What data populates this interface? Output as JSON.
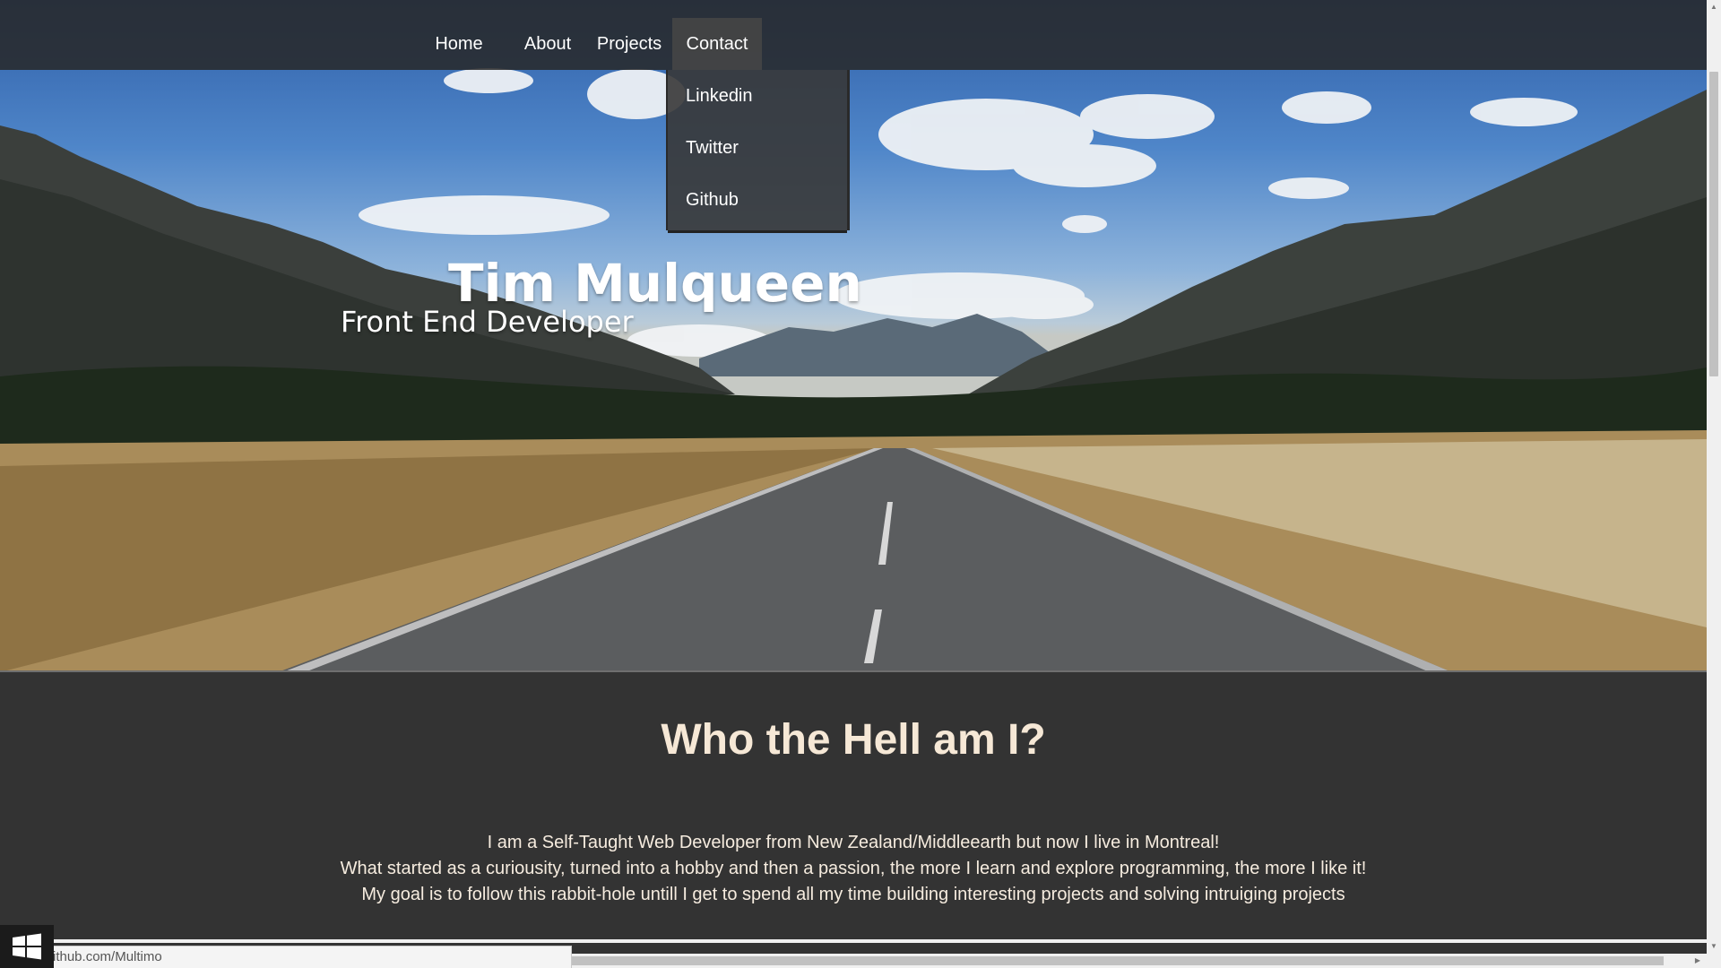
{
  "nav": {
    "items": [
      {
        "label": "Home"
      },
      {
        "label": "About"
      },
      {
        "label": "Projects"
      },
      {
        "label": "Contact"
      }
    ],
    "contact_dropdown": [
      {
        "label": "Linkedin"
      },
      {
        "label": "Twitter"
      },
      {
        "label": "Github"
      }
    ]
  },
  "hero": {
    "name": "Tim Mulqueen",
    "role": "Front End Developer"
  },
  "about": {
    "title": "Who the Hell am I?",
    "lines": [
      "I am a Self-Taught Web Developer from New Zealand/Middleearth but now I live in Montreal!",
      "What started as a curiousity, turned into a hobby and then a passion, the more I learn and explore programming, the more I like it!",
      "My goal is to follow this rabbit-hole untill I get to spend all my time building interesting projects and solving intruiging projects"
    ]
  },
  "status": {
    "url": "ithub.com/Multimo"
  },
  "icons": {
    "windows": "windows-logo-icon",
    "scroll_up": "scroll-up-arrow-icon",
    "scroll_down": "scroll-down-arrow-icon",
    "scroll_right": "scroll-right-arrow-icon"
  },
  "colors": {
    "navbar": "#282828",
    "page_bg": "#333333",
    "heading_text": "#f6e8d6",
    "body_text": "#f6ecdf"
  }
}
